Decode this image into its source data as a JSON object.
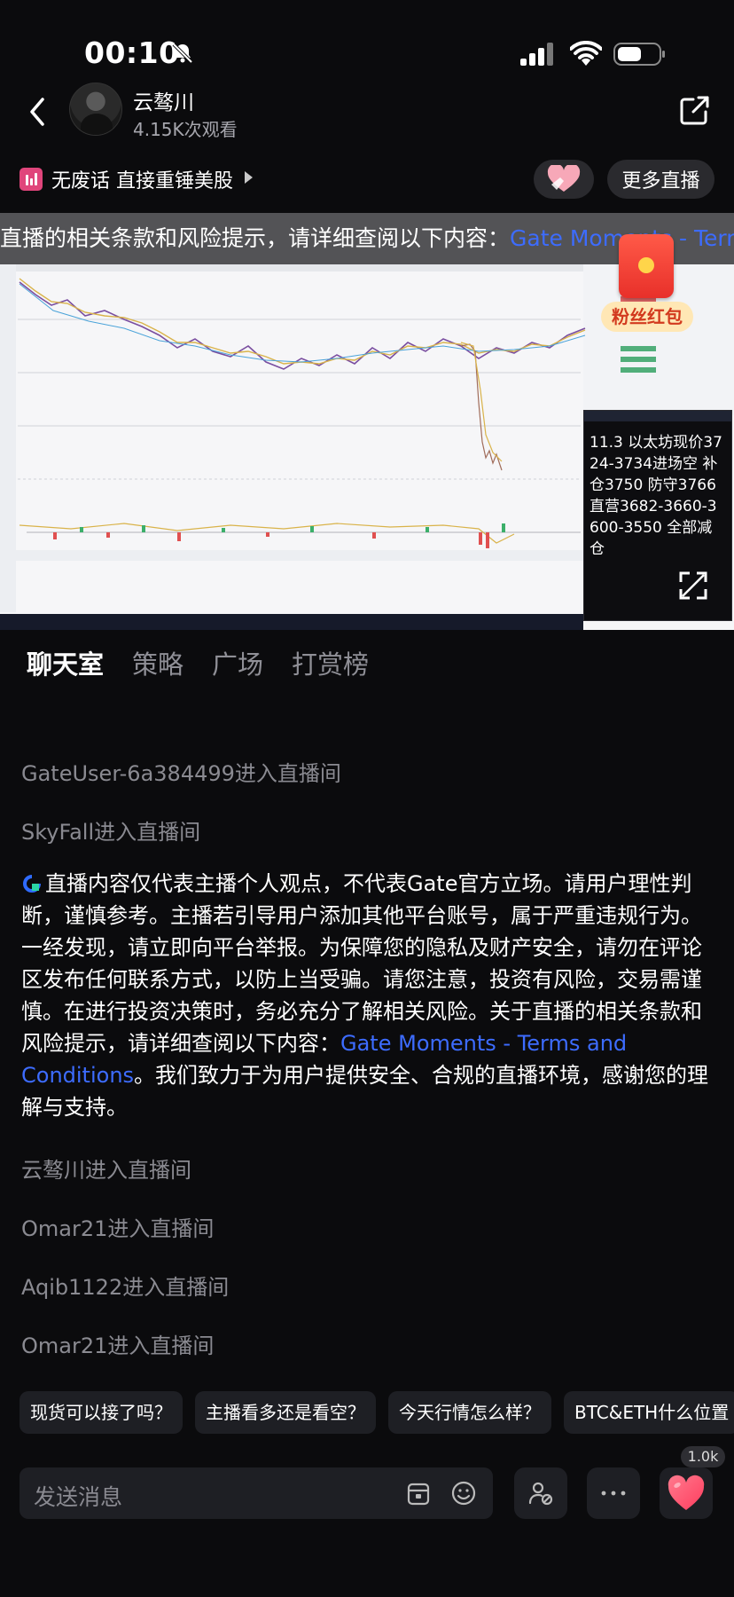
{
  "status_bar": {
    "time": "00:10"
  },
  "header": {
    "streamer_name": "云骜川",
    "view_count": "4.15K次观看"
  },
  "topic": {
    "title": "无废话 直接重锤美股",
    "more_live_label": "更多直播"
  },
  "video": {
    "marquee_text": "直播的相关条款和风险提示，请详细查阅以下内容：",
    "marquee_link": "Gate Moments - Terms",
    "red_packet_label": "粉丝红包",
    "overlay_text": "11.3  以太坊现价3724-3734进场空  补仓3750  防守3766 直营3682-3660-3600-3550       全部减仓"
  },
  "tabs": [
    {
      "label": "聊天室"
    },
    {
      "label": "策略"
    },
    {
      "label": "广场"
    },
    {
      "label": "打赏榜"
    }
  ],
  "chat": {
    "messages_top": [
      "GateUser-6a384499进入直播间",
      "SkyFall进入直播间"
    ],
    "notice_text": "直播内容仅代表主播个人观点，不代表Gate官方立场。请用户理性判断，谨慎参考。主播若引导用户添加其他平台账号，属于严重违规行为。一经发现，请立即向平台举报。为保障您的隐私及财产安全，请勿在评论区发布任何联系方式，以防上当受骗。请您注意，投资有风险，交易需谨慎。在进行投资决策时，务必充分了解相关风险。关于直播的相关条款和风险提示，请详细查阅以下内容：",
    "notice_link": "Gate Moments - Terms and Conditions",
    "notice_tail": "。我们致力于为用户提供安全、合规的直播环境，感谢您的理解与支持。",
    "messages_bottom": [
      "云骜川进入直播间",
      "Omar21进入直播间",
      "Aqib1122进入直播间",
      "Omar21进入直播间"
    ]
  },
  "quick_questions": [
    "现货可以接了吗？",
    "主播看多还是看空？",
    "今天行情怎么样？",
    "BTC&ETH什么位置"
  ],
  "input": {
    "placeholder": "发送消息"
  },
  "likes": {
    "count": "1.0k"
  },
  "colors": {
    "background": "#0b0b0d",
    "link": "#3d6cff",
    "accent_pink": "#e0457b",
    "like_heart": "#ff4d6d"
  },
  "icons": [
    "bell-off-icon",
    "signal-icon",
    "wifi-icon",
    "battery-icon",
    "back-icon",
    "share-icon",
    "heart-hands-icon",
    "fullscreen-icon",
    "gate-logo-icon",
    "card-icon",
    "emoji-icon",
    "user-settings-icon",
    "more-icon",
    "heart-icon"
  ]
}
